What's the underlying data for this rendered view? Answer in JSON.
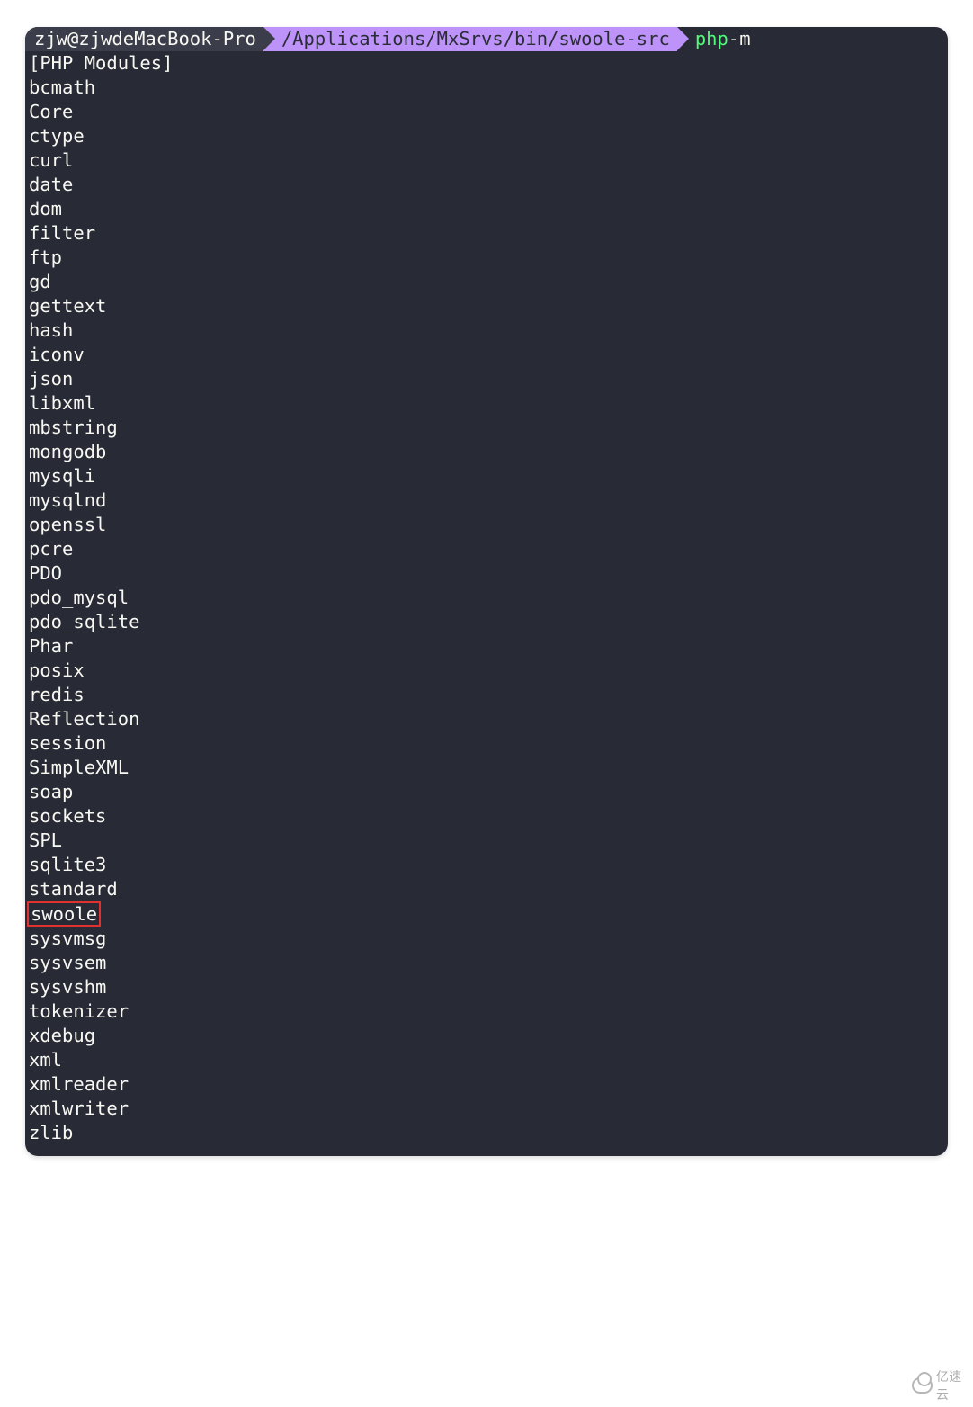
{
  "prompt": {
    "user": "zjw@zjwdeMacBook-Pro",
    "path": "/Applications/MxSrvs/bin/swoole-src",
    "command_bin": "php",
    "command_args": " -m"
  },
  "output": {
    "header": "[PHP Modules]",
    "modules": [
      "bcmath",
      "Core",
      "ctype",
      "curl",
      "date",
      "dom",
      "filter",
      "ftp",
      "gd",
      "gettext",
      "hash",
      "iconv",
      "json",
      "libxml",
      "mbstring",
      "mongodb",
      "mysqli",
      "mysqlnd",
      "openssl",
      "pcre",
      "PDO",
      "pdo_mysql",
      "pdo_sqlite",
      "Phar",
      "posix",
      "redis",
      "Reflection",
      "session",
      "SimpleXML",
      "soap",
      "sockets",
      "SPL",
      "sqlite3",
      "standard",
      "swoole",
      "sysvmsg",
      "sysvsem",
      "sysvshm",
      "tokenizer",
      "xdebug",
      "xml",
      "xmlreader",
      "xmlwriter",
      "zlib"
    ],
    "highlight": "swoole"
  },
  "watermark": {
    "text": "亿速云"
  }
}
